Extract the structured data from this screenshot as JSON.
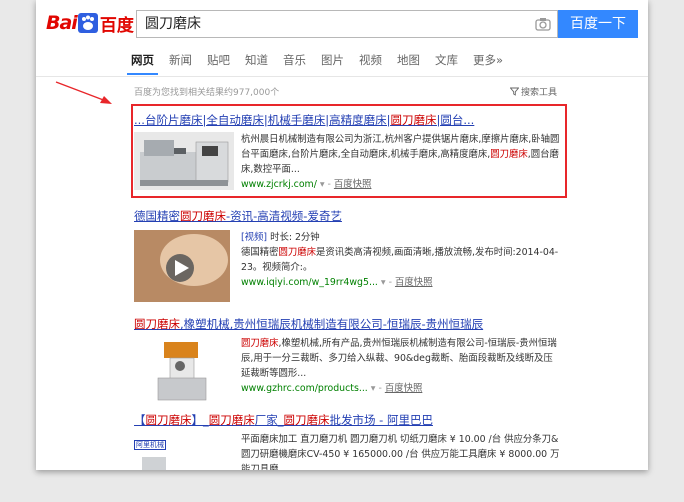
{
  "header": {
    "logo_text_latin": "Bai",
    "logo_text_cn": "百度",
    "search_value": "圆刀磨床",
    "search_button": "百度一下"
  },
  "tabs": [
    "网页",
    "新闻",
    "贴吧",
    "知道",
    "音乐",
    "图片",
    "视频",
    "地图",
    "文库",
    "更多»"
  ],
  "result_count": "百度为您找到相关结果约977,000个",
  "search_tools": "搜索工具",
  "results": [
    {
      "title": "...台阶片磨床|全自动磨床|机械手磨床|高精度磨床|圆刀磨床|圆台...",
      "snippet": "杭州晨日机械制造有限公司为浙江,杭州客户提供锯片磨床,摩擦片磨床,卧轴圆台平面磨床,台阶片磨床,全自动磨床,机械手磨床,高精度磨床,圆刀磨床,圆台磨床,数控平面...",
      "url": "www.zjcrkj.com/",
      "snapshot": "百度快照"
    },
    {
      "title": "德国精密圆刀磨床-资讯-高清视频-爱奇艺",
      "video_tag": "[视频]",
      "duration": "时长: 2分钟",
      "snippet": "德国精密圆刀磨床是资讯类高清视频,画面清晰,播放流畅,发布时间:2014-04-23。视频简介:。",
      "url": "www.iqiyi.com/w_19rr4wg5...",
      "snapshot": "百度快照"
    },
    {
      "title": "圆刀磨床,橡塑机械,贵州恒瑞辰机械制造有限公司-恒瑞辰-贵州恒瑞辰",
      "snippet": "圆刀磨床,橡塑机械,所有产品,贵州恒瑞辰机械制造有限公司-恒瑞辰-贵州恒瑞辰,用于一分三裁断、多刀给入纵裁、90&deg裁断、胎面段裁断及线断及压延裁断等圆形...",
      "url": "www.gzhrc.com/products...",
      "snapshot": "百度快照"
    },
    {
      "title": "【圆刀磨床】_圆刀磨床厂家_圆刀磨床批发市场 - 阿里巴巴",
      "snippet": "平面磨床加工 直刀磨刀机 圆刀磨刀机 切纸刀磨床 ¥ 10.00 /台 供应分条刀&圆刀研磨機磨床CV-450 ¥ 165000.00 /台 供应万能工具磨床 ¥ 8000.00 万能刀具磨",
      "thumb_label": "阿里机械"
    }
  ],
  "colors": {
    "brand": "#e10601",
    "link": "#2440b3",
    "keyword": "#c00000",
    "url": "#008000",
    "button": "#3388ff",
    "highlight": "#e8262a"
  }
}
